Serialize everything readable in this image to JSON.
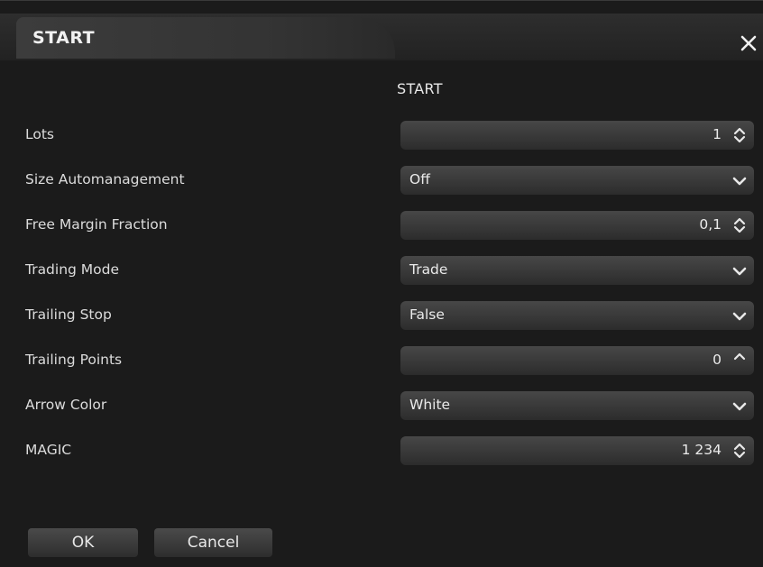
{
  "window": {
    "title": "START"
  },
  "section": {
    "header": "START"
  },
  "params": [
    {
      "label": "Lots",
      "value": "1",
      "control": "spin"
    },
    {
      "label": "Size Automanagement",
      "value": "Off",
      "control": "select"
    },
    {
      "label": "Free Margin Fraction",
      "value": "0,1",
      "control": "spin"
    },
    {
      "label": "Trading Mode",
      "value": "Trade",
      "control": "select"
    },
    {
      "label": "Trailing Stop",
      "value": "False",
      "control": "select"
    },
    {
      "label": "Trailing Points",
      "value": "0",
      "control": "spin-up"
    },
    {
      "label": "Arrow Color",
      "value": "White",
      "control": "select"
    },
    {
      "label": "MAGIC",
      "value": "1 234",
      "control": "spin"
    }
  ],
  "buttons": {
    "ok": "OK",
    "cancel": "Cancel"
  },
  "icons": {
    "close": "close-icon",
    "spin": "spinner-icon",
    "dropdown": "chevron-down-icon"
  }
}
